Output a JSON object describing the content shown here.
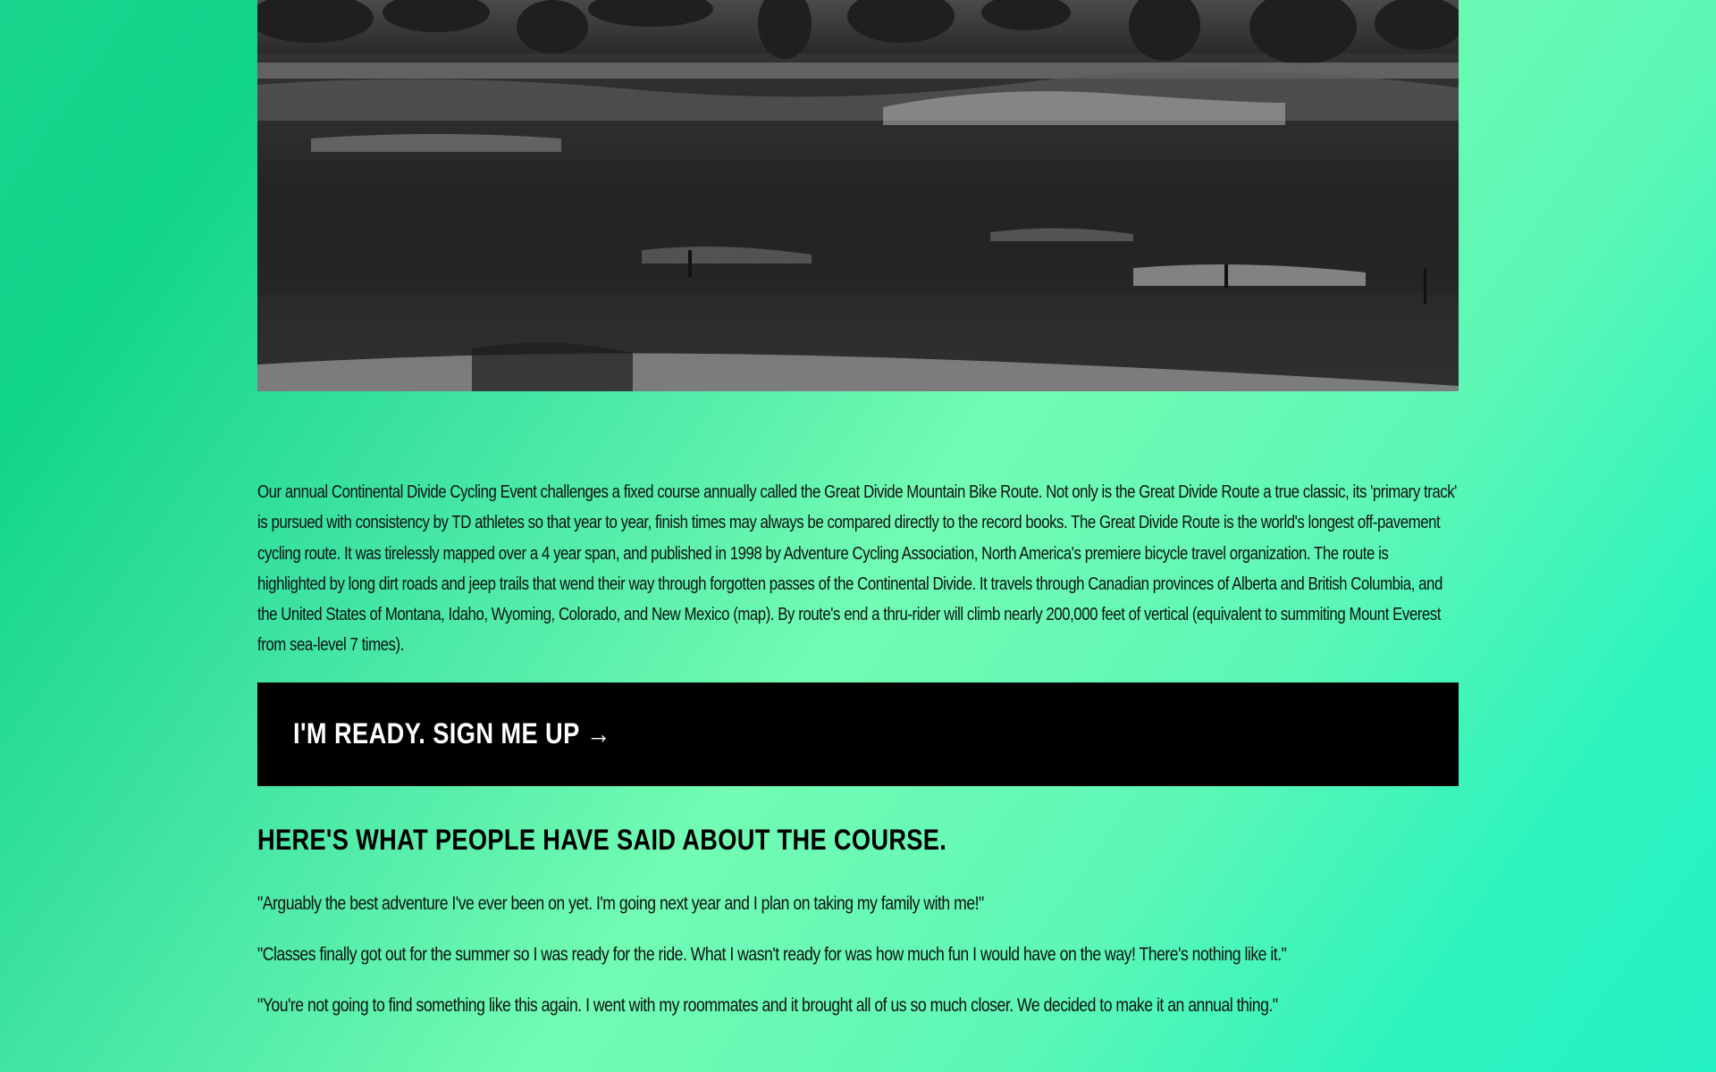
{
  "hero": {
    "image": "grayscale-prairie-landscape-photo"
  },
  "description": {
    "text": "Our annual Continental Divide Cycling Event challenges a fixed course annually called the Great Divide Mountain Bike Route. Not only is the Great Divide Route a true classic, its 'primary track' is pursued with consistency by TD athletes so that year to year, finish times may always be compared directly to the record books. The Great Divide Route is the world's longest off-pavement cycling route. It was tirelessly mapped over a 4 year span, and published in 1998 by Adventure Cycling Association, North America's premiere bicycle travel organization. The route is highlighted by long dirt roads and jeep trails that wend their way through forgotten passes of the Continental Divide. It travels through Canadian provinces of Alberta and British Columbia, and the United States of Montana, Idaho, Wyoming, Colorado, and New Mexico (map). By route's end a thru-rider will climb nearly 200,000 feet of vertical (equivalent to summiting Mount Everest from sea-level 7 times)."
  },
  "cta": {
    "label": "I'M READY. SIGN ME UP →"
  },
  "testimonials": {
    "heading": "HERE'S WHAT PEOPLE HAVE SAID ABOUT THE COURSE.",
    "quotes": [
      "\"Arguably the best adventure I've ever been on yet. I'm going next year and I plan on taking my family with me!\"",
      "\"Classes finally got out for the summer so I was ready for the ride. What I wasn't ready for was how much fun I would have on the way! There's nothing like it.\"",
      "\"You're not going to find something like this again. I went with my roommates and it brought all of us so much closer. We decided to make it an annual thing.\""
    ]
  },
  "colors": {
    "background_start": "#10d48a",
    "background_mid": "#72fbb3",
    "background_end": "#25f2c4",
    "button_bg": "#000000",
    "button_text": "#ffffff"
  }
}
